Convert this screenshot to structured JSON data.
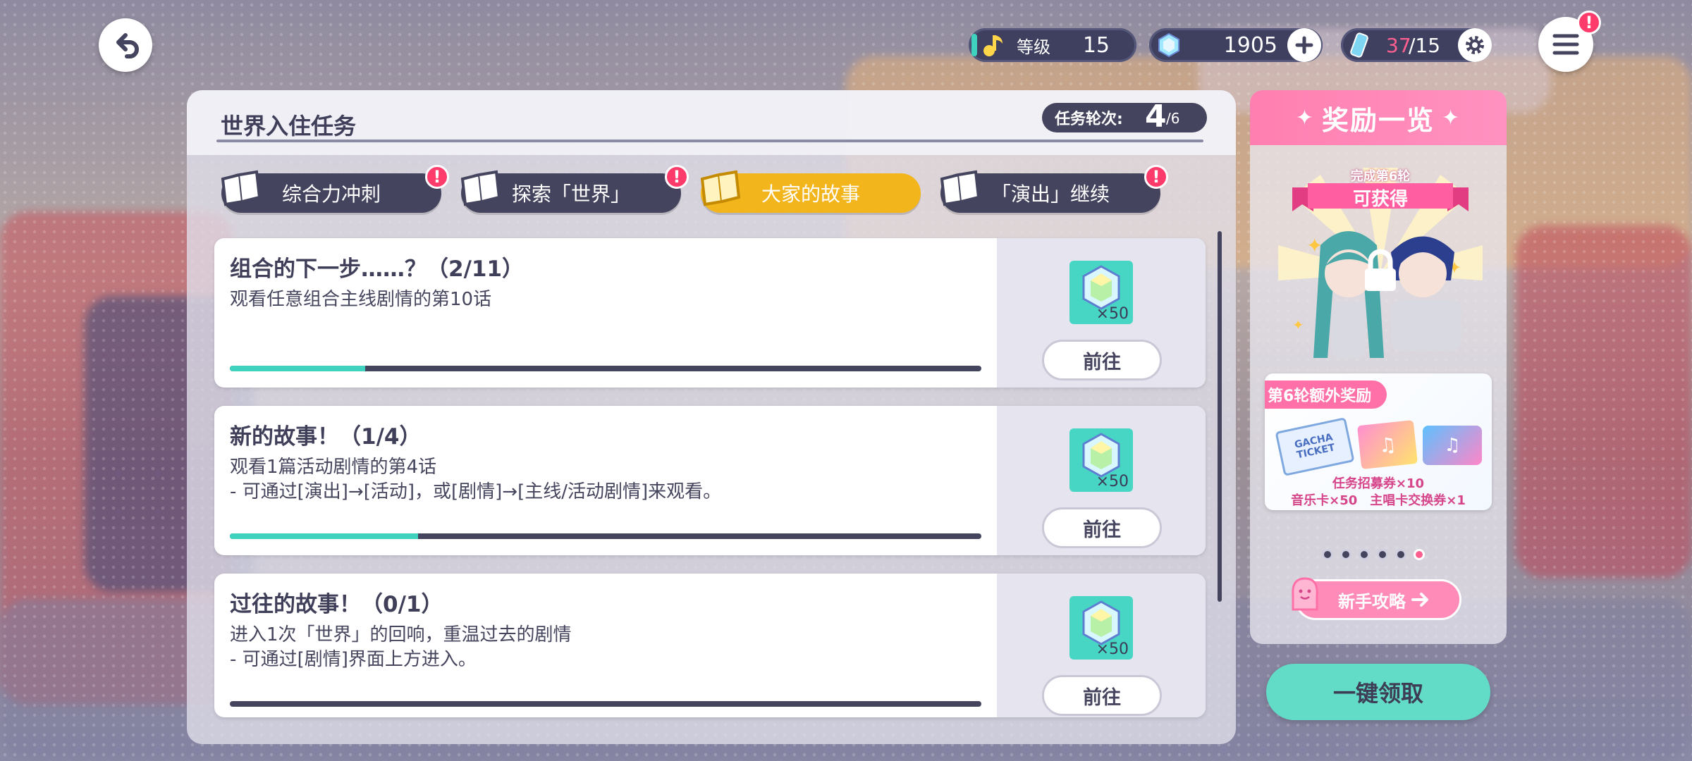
{
  "header": {
    "level_label": "等级",
    "level_value": "15",
    "gems": "1905",
    "stamina_current": "37",
    "stamina_max": "/15"
  },
  "panel": {
    "title": "世界入住任务",
    "round_label": "任务轮次:",
    "round_current": "4",
    "round_total": "/6"
  },
  "tabs": [
    {
      "label": "综合力冲刺",
      "alert": true
    },
    {
      "label": "探索「世界」",
      "alert": true
    },
    {
      "label": "大家的故事",
      "alert": false
    },
    {
      "label": "「演出」继续",
      "alert": true
    }
  ],
  "missions": [
    {
      "title": "组合的下一步……？（2/11）",
      "desc": "观看任意组合主线剧情的第10话",
      "progress": 0.18,
      "reward_qty": "×50",
      "button": "前往"
    },
    {
      "title": "新的故事！（1/4）",
      "desc": "观看1篇活动剧情的第4话\n- 可通过[演出]→[活动]，或[剧情]→[主线/活动剧情]来观看。",
      "progress": 0.25,
      "reward_qty": "×50",
      "button": "前往"
    },
    {
      "title": "过往的故事！（0/1）",
      "desc": "进入1次「世界」的回响，重温过去的剧情\n- 可通过[剧情]界面上方进入。",
      "progress": 0.0,
      "reward_qty": "×50",
      "button": "前往"
    }
  ],
  "rewards": {
    "title": "奖励一览",
    "ribbon_small": "完成第6轮",
    "ribbon_big": "可获得",
    "extra_title": "第6轮额外奖励",
    "ticket_text": "GACHA TICKET",
    "item_line1": "任务招募券×10",
    "item_line2": "音乐卡×50　主唱卡交换券×1",
    "dots": 6,
    "active_dot": 6,
    "guide": "新手攻略"
  },
  "claim_button": "一键领取",
  "colors": {
    "accent": "#62dcc7",
    "tab_active": "#f2b51c",
    "dark": "#44445e",
    "pink": "#ff7fb0",
    "alert": "#ff3b6b"
  }
}
